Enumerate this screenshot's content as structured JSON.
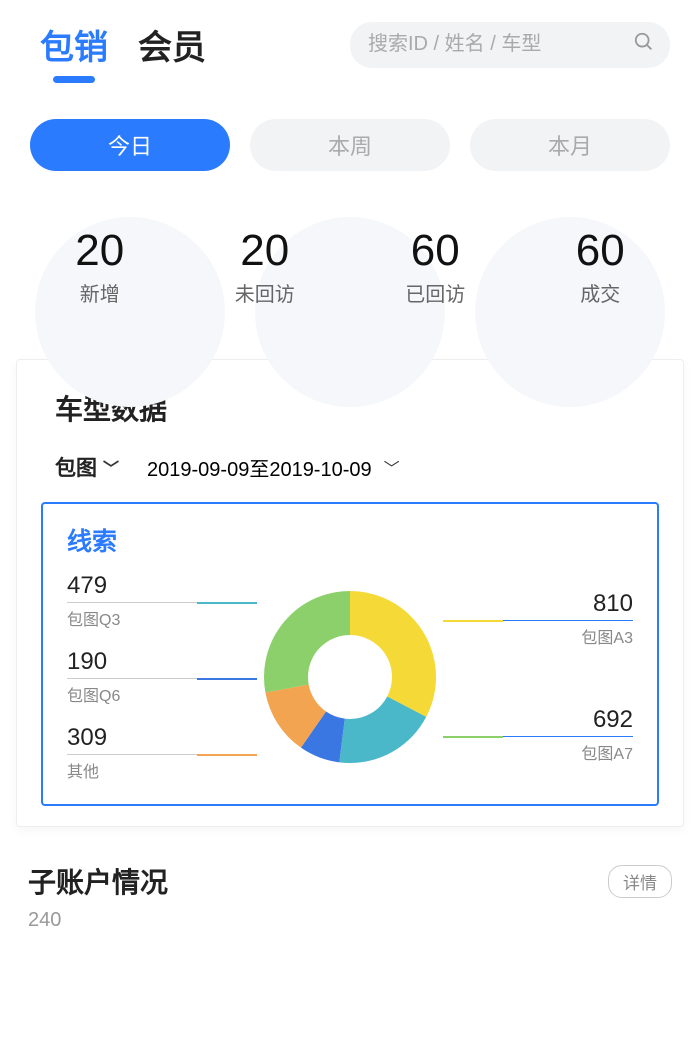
{
  "header": {
    "tab_a": "包销",
    "tab_b": "会员",
    "search_placeholder": "搜索ID / 姓名 / 车型"
  },
  "period": {
    "today": "今日",
    "week": "本周",
    "month": "本月"
  },
  "stats": [
    {
      "num": "20",
      "label": "新增"
    },
    {
      "num": "20",
      "label": "未回访"
    },
    {
      "num": "60",
      "label": "已回访"
    },
    {
      "num": "60",
      "label": "成交"
    }
  ],
  "model_card": {
    "title": "车型数据",
    "filter_name": "包图",
    "date_range": "2019-09-09至2019-10-09",
    "chart_title": "线索"
  },
  "chart_data": {
    "type": "pie",
    "title": "线索",
    "series": [
      {
        "name": "包图Q3",
        "value": 479,
        "color": "#4bb8c9"
      },
      {
        "name": "包图Q6",
        "value": 190,
        "color": "#3b77e3"
      },
      {
        "name": "其他",
        "value": 309,
        "color": "#f3a451"
      },
      {
        "name": "包图A7",
        "value": 692,
        "color": "#8bd06b"
      },
      {
        "name": "包图A3",
        "value": 810,
        "color": "#f4d937"
      }
    ]
  },
  "sub": {
    "title": "子账户情况",
    "btn": "详情",
    "num": "240"
  }
}
